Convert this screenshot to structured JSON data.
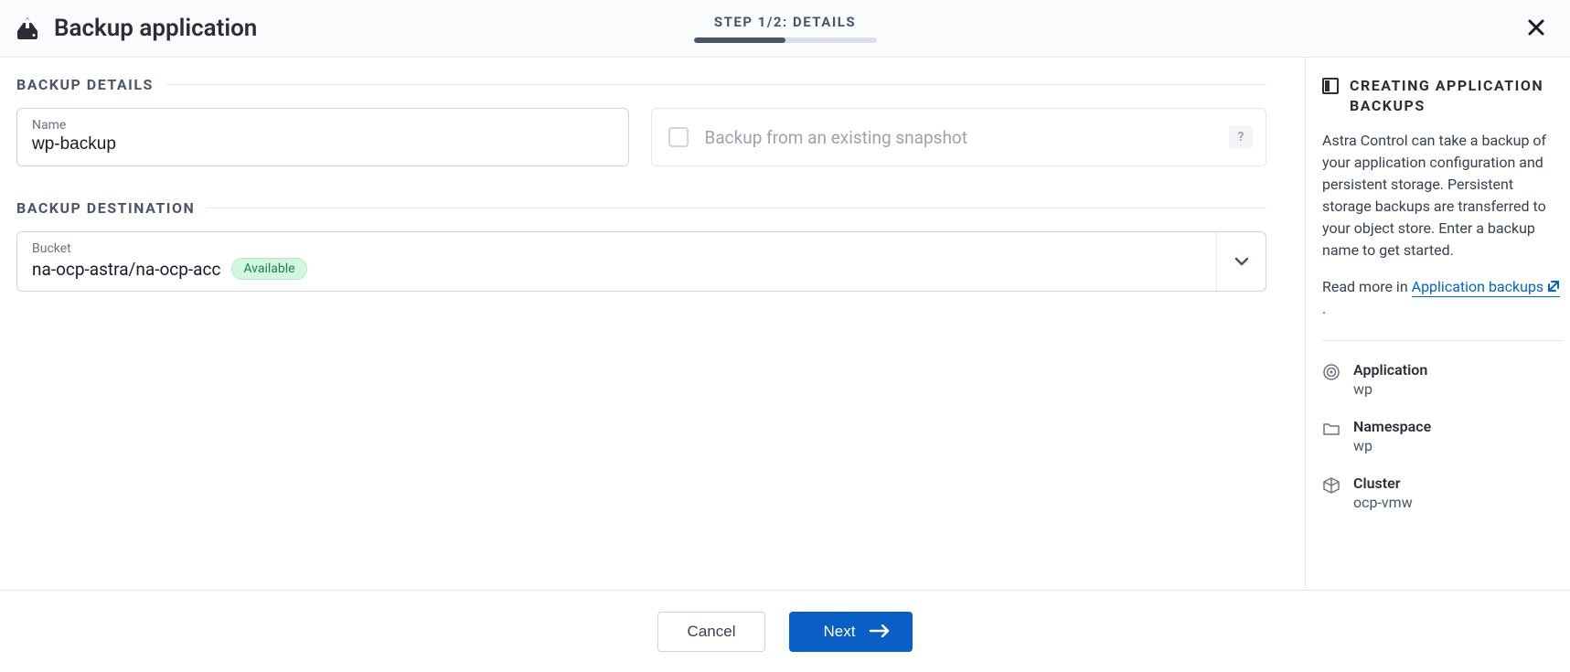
{
  "header": {
    "title": "Backup application",
    "step_text": "STEP 1/2: DETAILS"
  },
  "sections": {
    "details_title": "BACKUP DETAILS",
    "destination_title": "BACKUP DESTINATION"
  },
  "form": {
    "name_label": "Name",
    "name_value": "wp-backup",
    "snapshot_checkbox_label": "Backup from an existing snapshot",
    "help_symbol": "?"
  },
  "bucket": {
    "label": "Bucket",
    "value": "na-ocp-astra/na-ocp-acc",
    "status_badge": "Available"
  },
  "sidebar": {
    "title": "CREATING APPLICATION BACKUPS",
    "description": "Astra Control can take a backup of your application configuration and persistent storage. Persistent storage backups are transferred to your object store. Enter a backup name to get started.",
    "read_more_prefix": "Read more in ",
    "link_text": "Application backups",
    "meta": {
      "app_label": "Application",
      "app_value": "wp",
      "ns_label": "Namespace",
      "ns_value": "wp",
      "cluster_label": "Cluster",
      "cluster_value": "ocp-vmw"
    }
  },
  "footer": {
    "cancel": "Cancel",
    "next": "Next"
  }
}
